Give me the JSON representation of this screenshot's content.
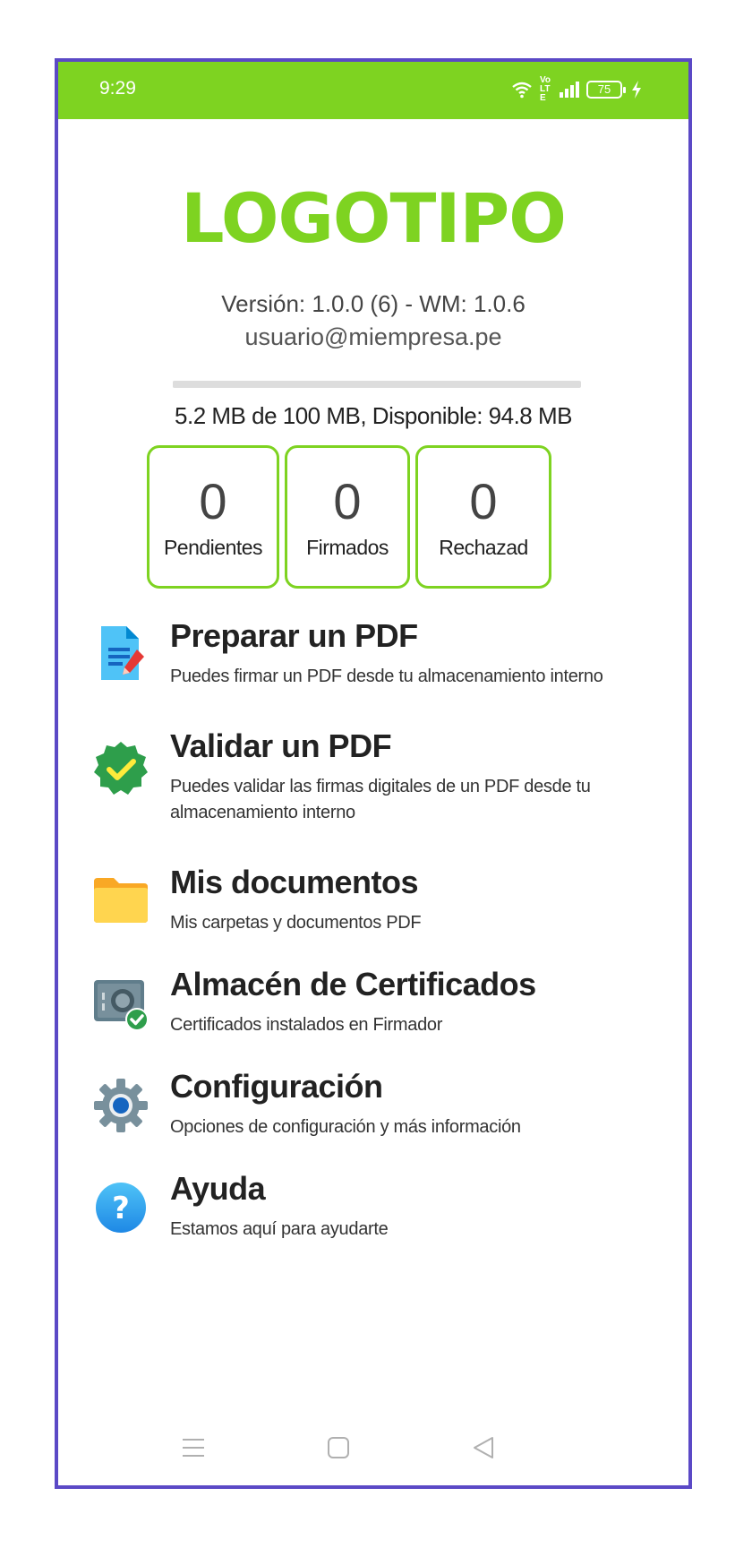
{
  "status": {
    "time": "9:29",
    "volte": "Vo LTE",
    "battery": "75"
  },
  "app": {
    "logo": "LOGOTIPO",
    "version": "Versión: 1.0.0 (6) - WM: 1.0.6",
    "email": "usuario@miempresa.pe",
    "storage_text": "5.2 MB de 100 MB, Disponible: 94.8 MB",
    "storage_used_fraction": 0.052
  },
  "counters": [
    {
      "value": "0",
      "label": "Pendientes"
    },
    {
      "value": "0",
      "label": "Firmados"
    },
    {
      "value": "0",
      "label": "Rechazad"
    }
  ],
  "menu": [
    {
      "title": "Preparar un PDF",
      "subtitle": "Puedes firmar un PDF desde tu almacenamiento interno",
      "icon": "document-edit-icon"
    },
    {
      "title": "Validar un PDF",
      "subtitle": "Puedes validar las firmas digitales de un PDF desde tu almacenamiento interno",
      "icon": "verified-badge-icon"
    },
    {
      "title": "Mis documentos",
      "subtitle": "Mis carpetas y documentos PDF",
      "icon": "folder-icon"
    },
    {
      "title": "Almacén de Certificados",
      "subtitle": "Certificados instalados en Firmador",
      "icon": "safe-icon"
    },
    {
      "title": "Configuración",
      "subtitle": "Opciones de configuración y más información",
      "icon": "gear-icon"
    },
    {
      "title": "Ayuda",
      "subtitle": "Estamos aquí para ayudarte",
      "icon": "help-icon"
    }
  ],
  "colors": {
    "accent": "#7ed321",
    "frame": "#5b49c6"
  }
}
